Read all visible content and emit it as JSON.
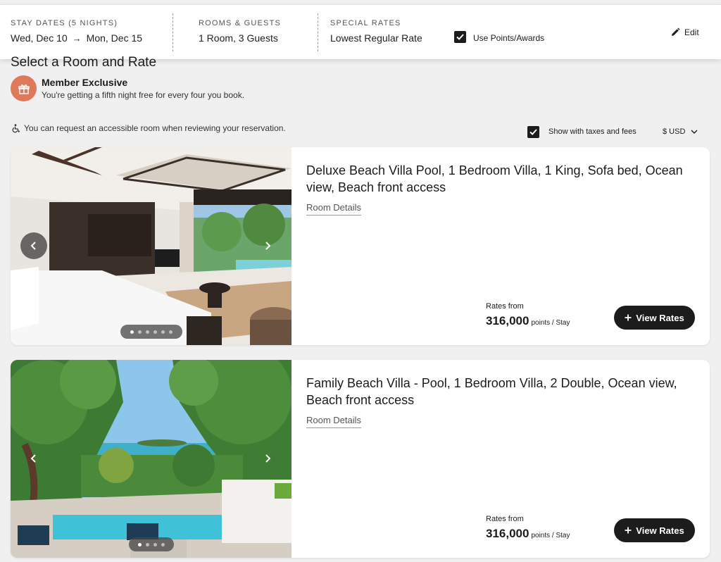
{
  "header": {
    "stay_dates_label": "STAY DATES (5 NIGHTS)",
    "check_in": "Wed, Dec 10",
    "check_out": "Mon, Dec 15",
    "rooms_guests_label": "ROOMS & GUESTS",
    "rooms_guests_value": "1 Room, 3 Guests",
    "special_rates_label": "SPECIAL RATES",
    "special_rates_value": "Lowest Regular Rate",
    "use_points_label": "Use Points/Awards",
    "use_points_checked": true,
    "edit_label": "Edit"
  },
  "section": {
    "title": "Select a Room and Rate"
  },
  "member": {
    "title": "Member Exclusive",
    "subtitle": "You're getting a fifth night free for every four you book."
  },
  "accessibility_note": "You can request an accessible room when reviewing your reservation.",
  "filters": {
    "taxes_label": "Show with taxes and fees",
    "taxes_checked": true,
    "currency": "$ USD"
  },
  "rooms": [
    {
      "title": "Deluxe Beach Villa Pool, 1 Bedroom Villa, 1 King, Sofa bed, Ocean view, Beach front access",
      "details_label": "Room Details",
      "rates_from_label": "Rates from",
      "rate": "316,000",
      "rate_unit": "points / Stay",
      "view_rates_label": "View Rates",
      "photo_count": 6,
      "active_photo": 1
    },
    {
      "title": "Family Beach Villa - Pool, 1 Bedroom Villa, 2 Double, Ocean view, Beach front access",
      "details_label": "Room Details",
      "rates_from_label": "Rates from",
      "rate": "316,000",
      "rate_unit": "points / Stay",
      "view_rates_label": "View Rates",
      "photo_count": 4,
      "active_photo": 1
    }
  ],
  "colors": {
    "accent": "#e0785a",
    "button": "#1c1c1c",
    "background": "#f0f0f0"
  },
  "icons": {
    "arrow": "arrow-right-icon",
    "edit": "pencil-icon",
    "member": "gift-icon",
    "accessible": "wheelchair-icon",
    "currency_toggle": "chevron-down-icon",
    "prev": "chevron-left-icon",
    "next": "chevron-right-icon",
    "plus": "plus-icon"
  }
}
